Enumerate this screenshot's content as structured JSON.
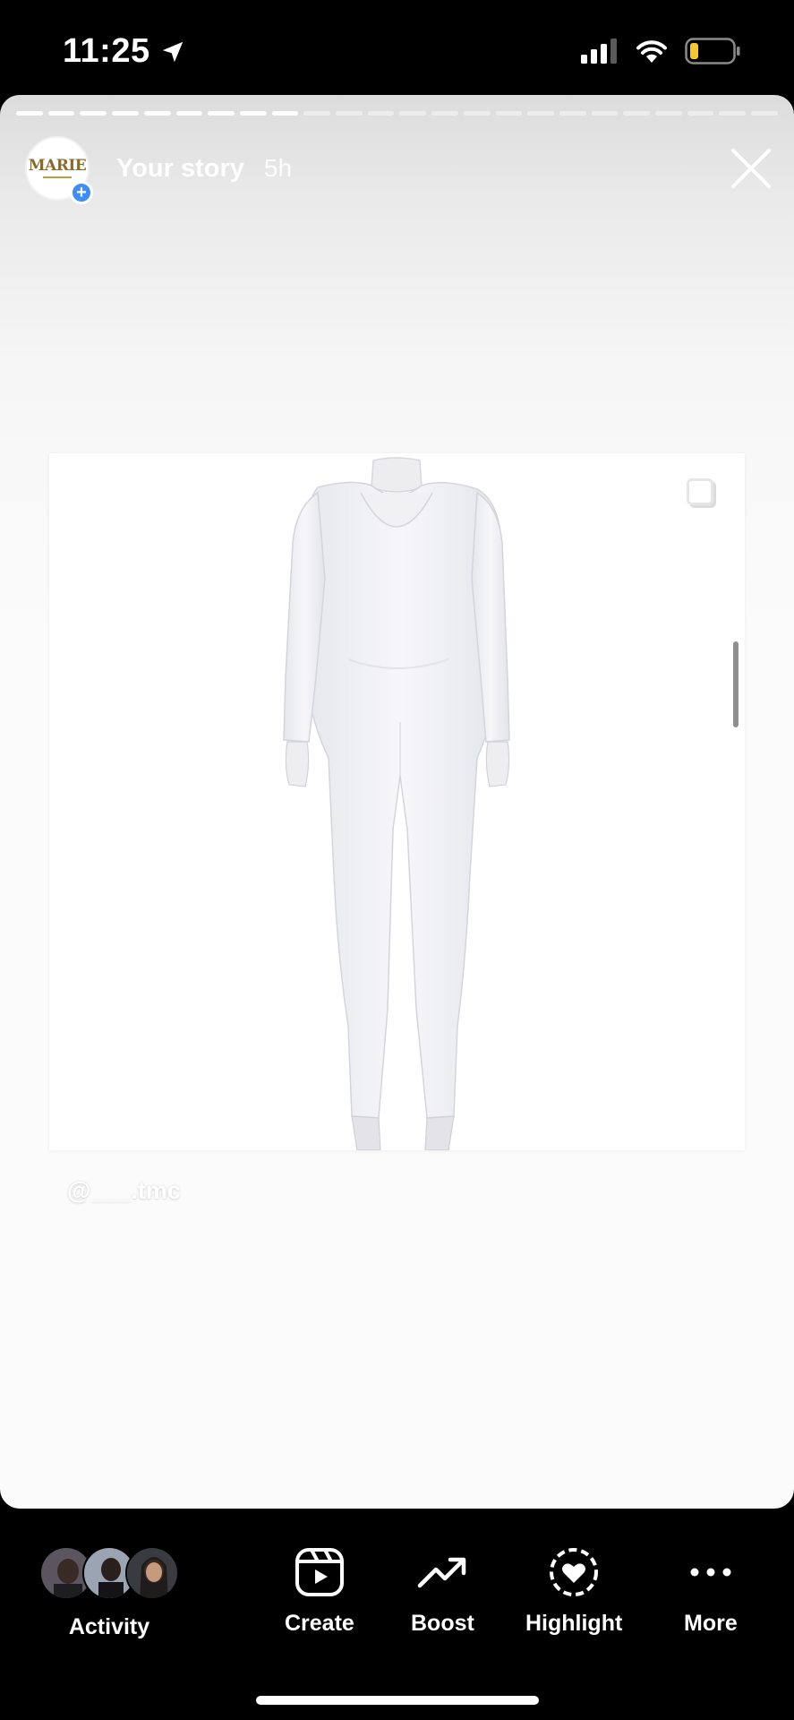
{
  "status_bar": {
    "time": "11:25",
    "icons": [
      "location-arrow-icon",
      "cellular-signal-icon",
      "wifi-icon",
      "battery-icon"
    ],
    "battery_color": "#f5c62d"
  },
  "story": {
    "progress_segments_total": 24,
    "progress_segments_done": 9,
    "username": "Your story",
    "time_ago": "5h",
    "avatar_logo_text": "MARIE",
    "mention": "@___.tmc",
    "accent_color": "#3e8ef7",
    "image_description_icon": "white-long-sleeve-jumpsuit-on-mannequin"
  },
  "bottom_bar": {
    "actions": [
      {
        "label": "Activity",
        "icon": "activity-avatars"
      },
      {
        "label": "Create",
        "icon": "reels-create-icon"
      },
      {
        "label": "Boost",
        "icon": "trending-up-icon"
      },
      {
        "label": "Highlight",
        "icon": "highlight-heart-icon"
      },
      {
        "label": "More",
        "icon": "more-dots-icon"
      }
    ]
  }
}
